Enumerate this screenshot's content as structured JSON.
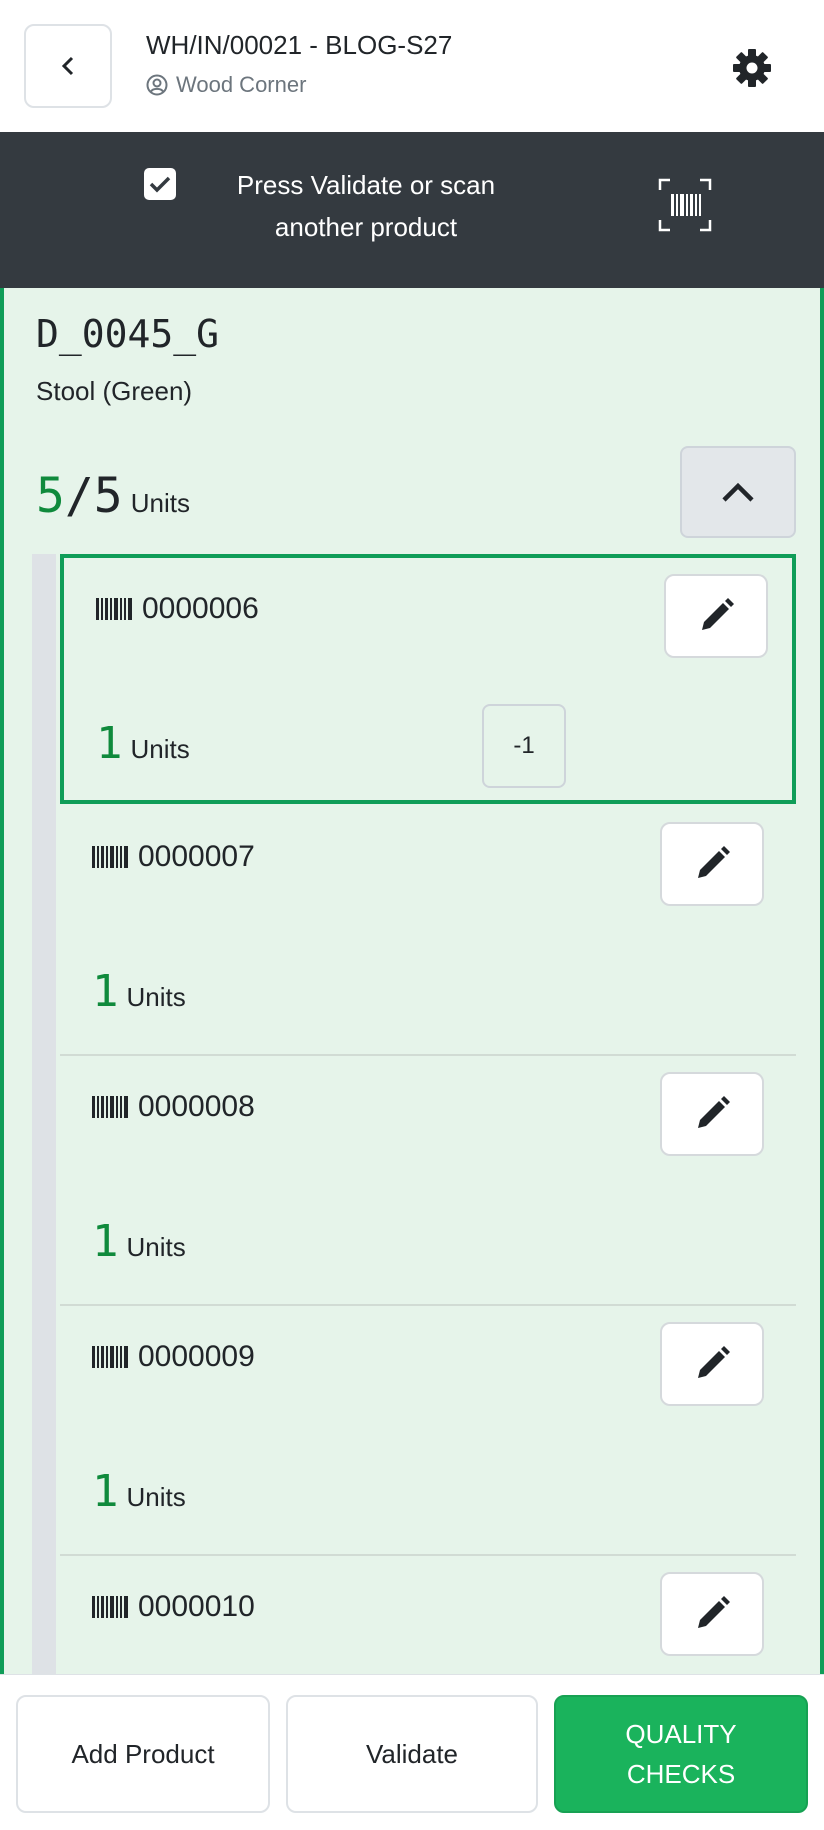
{
  "header": {
    "title": "WH/IN/00021 - BLOG-S27",
    "partner": "Wood Corner"
  },
  "banner": {
    "message": "Press Validate or scan another product"
  },
  "product": {
    "code": "D_0045_G",
    "name": "Stool (Green)",
    "qty_done": "5",
    "qty_total": "/5",
    "unit": "Units"
  },
  "lines": [
    {
      "lot": "0000006",
      "qty": "1",
      "unit": "Units",
      "minus": "-1",
      "selected": true
    },
    {
      "lot": "0000007",
      "qty": "1",
      "unit": "Units"
    },
    {
      "lot": "0000008",
      "qty": "1",
      "unit": "Units"
    },
    {
      "lot": "0000009",
      "qty": "1",
      "unit": "Units"
    },
    {
      "lot": "0000010",
      "qty": "",
      "unit": ""
    }
  ],
  "footer": {
    "add_product": "Add Product",
    "validate": "Validate",
    "quality_checks": "QUALITY CHECKS"
  },
  "colors": {
    "accent": "#0f9d58",
    "card_bg": "#e6f4ea",
    "banner_bg": "#343a40"
  }
}
